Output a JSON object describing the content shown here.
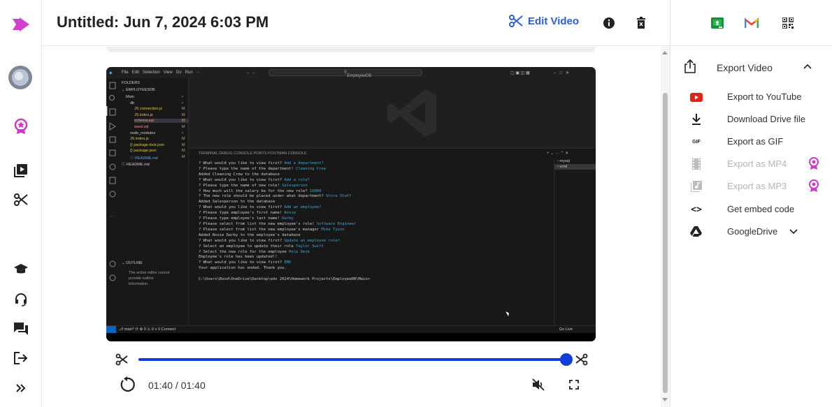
{
  "header": {
    "title": "Untitled: Jun 7, 2024 6:03 PM",
    "edit_label": "Edit Video"
  },
  "colors": {
    "accent": "#2b5fd9",
    "brand": "#c83cc8",
    "slider": "#0f3fd8"
  },
  "rail_icons": [
    "logo-icon",
    "avatar",
    "award-icon",
    "video-library-icon",
    "scissors-icon",
    "school-icon",
    "support-icon",
    "chat-icon",
    "logout-icon",
    "expand-icon"
  ],
  "player": {
    "time": "01:40 / 01:40",
    "trim_end_fraction": 1.0
  },
  "export": {
    "title": "Export Video",
    "options": [
      {
        "label": "Export to YouTube",
        "icon": "youtube-icon",
        "enabled": true
      },
      {
        "label": "Download Drive file",
        "icon": "download-icon",
        "enabled": true
      },
      {
        "label": "Export as GIF",
        "icon": "gif-icon",
        "icon_text": "GIF",
        "enabled": true
      },
      {
        "label": "Export as MP4",
        "icon": "film-icon",
        "enabled": false,
        "premium": true
      },
      {
        "label": "Export as MP3",
        "icon": "music-icon",
        "enabled": false,
        "premium": true
      },
      {
        "label": "Get embed code",
        "icon": "code-icon",
        "icon_text": "<>",
        "enabled": true
      },
      {
        "label": "GoogleDrive",
        "icon": "google-drive-icon",
        "enabled": true
      }
    ]
  },
  "screen_recording": {
    "menu": [
      "File",
      "Edit",
      "Selection",
      "View",
      "Go",
      "Run",
      "···"
    ],
    "search": "EmployeeDB",
    "sidebar": {
      "folders_label": "FOLDERS",
      "root": "EMPLOYEESDB",
      "items": [
        {
          "name": "Main",
          "mark": "•"
        },
        {
          "name": "db",
          "mark": "•"
        },
        {
          "name": "JS connection.js",
          "mark": "M"
        },
        {
          "name": "JS index.js",
          "mark": "M"
        },
        {
          "name": "schema.sql",
          "mark": "M"
        },
        {
          "name": "seed.sql",
          "mark": "M"
        },
        {
          "name": "node_modules",
          "mark": "•"
        },
        {
          "name": "JS index.js",
          "mark": "M"
        },
        {
          "name": "{} package-lock.json",
          "mark": "M"
        },
        {
          "name": "{} package.json",
          "mark": "M"
        },
        {
          "name": "ⓘ README.md",
          "mark": "M"
        },
        {
          "name": "ⓘ README.md",
          "mark": ""
        }
      ],
      "outline_label": "OUTLINE",
      "outline_text": [
        "The active editor cannot",
        "provide outline",
        "information."
      ]
    },
    "terminal_tabs": "TERMINAL    DEBUG CONSOLE    PORTS    POSTMAN CONSOLE",
    "terminal_lines": [
      [
        "? What would you like to view first? ",
        "Add a department?"
      ],
      [
        "? Please type the name of the department! ",
        "Cleaning Crew"
      ],
      [
        "Added Cleaning Crew to the database",
        ""
      ],
      [
        "? What would you like to view first? ",
        "Add a role?"
      ],
      [
        "? Please type the name of new role! ",
        "Salesperson"
      ],
      [
        "? How much will the salary be for the new role? ",
        "10000"
      ],
      [
        "? The new role should be placed under what department? ",
        "Store Staff"
      ],
      [
        "Added Salesperson to the database",
        ""
      ],
      [
        "? What would you like to view first? ",
        "Add an employee?"
      ],
      [
        "? Please type employee's first name! ",
        "Roxie"
      ],
      [
        "? Please type employee's last name! ",
        "Darby"
      ],
      [
        "? Please select from list the new employee's role! ",
        "Software Engineer"
      ],
      [
        "? Please select from list the new employee's manager ",
        "Mike Tyson"
      ],
      [
        "Added Roxie Darby to the employee's database",
        ""
      ],
      [
        "? What would you like to view first? ",
        "Update an employee role?"
      ],
      [
        "? Select an employee to update their role ",
        "Taylor Swift"
      ],
      [
        "? Select the new role for the employee ",
        "Help Desk"
      ],
      [
        "Employee's role has been updated!!",
        ""
      ],
      [
        "? What would you like to view first? ",
        "END"
      ],
      [
        "Your application has ended. Thank you.",
        ""
      ],
      [
        "",
        ""
      ],
      [
        "C:\\Users\\Roxd\\OneDrive\\Desktop\\edx 2024\\Homework Projects\\EmployeeDB\\Main>",
        ""
      ]
    ],
    "terminal_list": [
      "mysql",
      "cmd"
    ],
    "status_left": "⎇ main*  ⟳  ⊗ 0 ⚠ 0   ≡ 0   Connect",
    "status_right": "Go Live"
  }
}
